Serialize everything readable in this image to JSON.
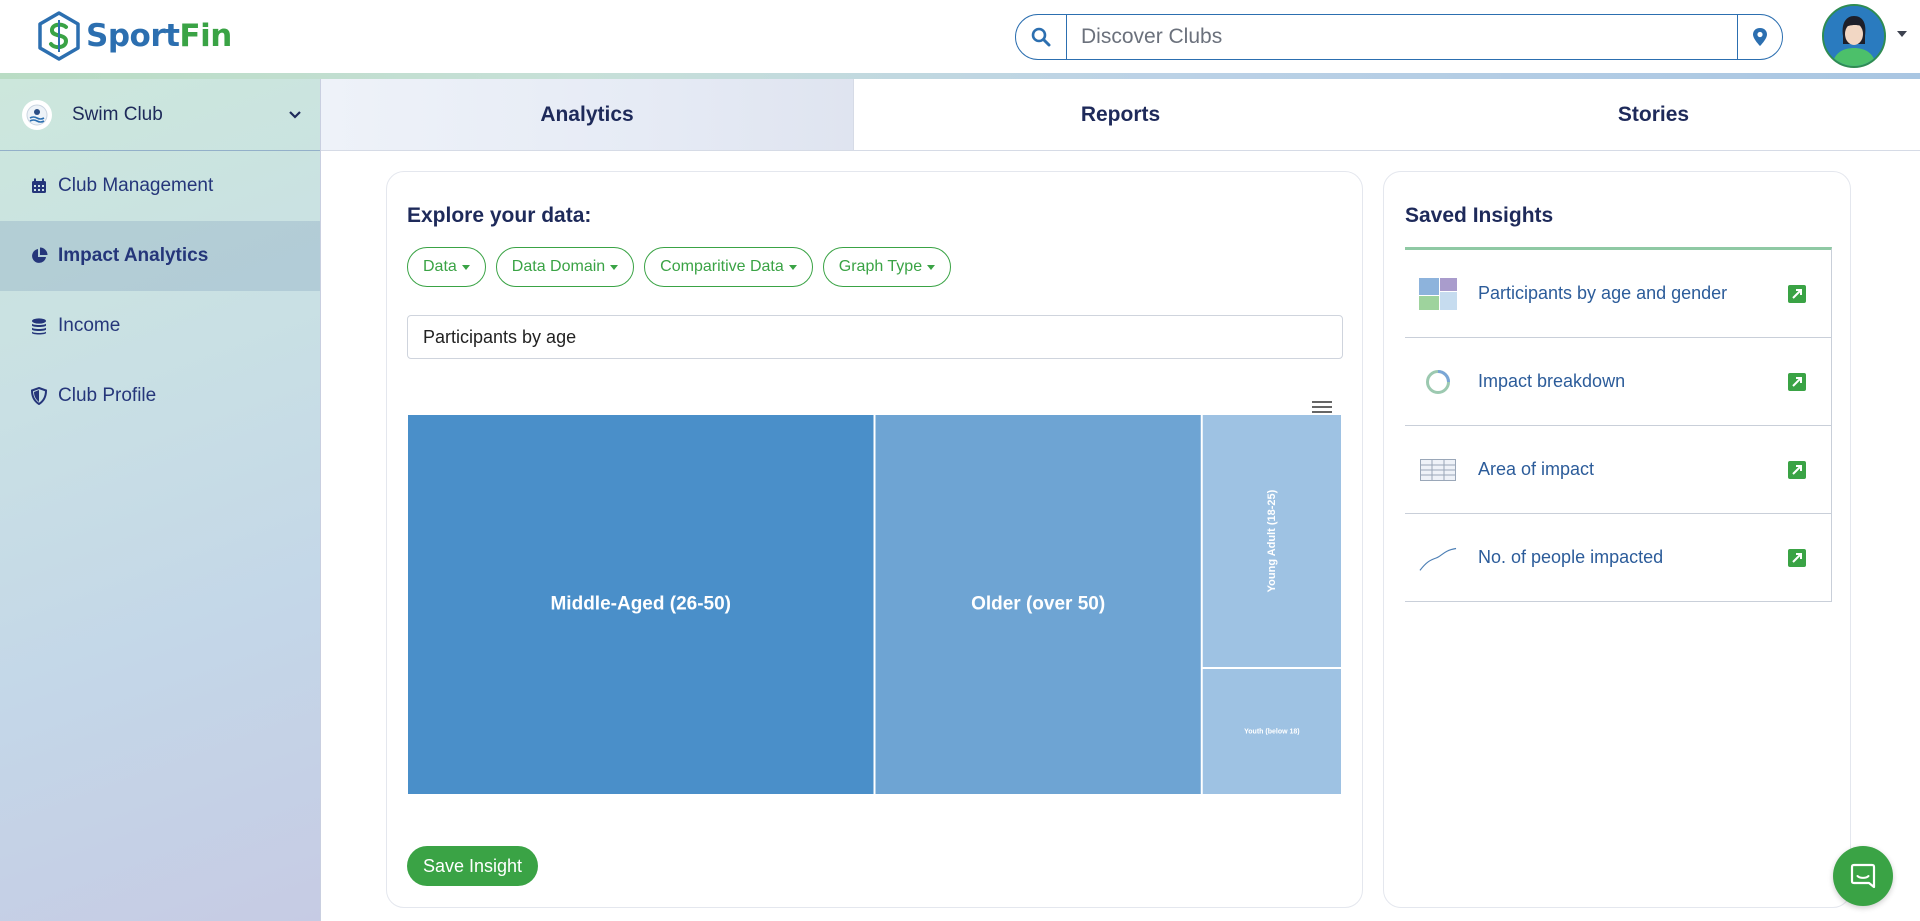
{
  "brand": {
    "name_part1": "Sport",
    "name_part2": "Fin",
    "primary_color": "#2c6fb0",
    "accent_color": "#3aa345"
  },
  "header": {
    "search_placeholder": "Discover Clubs",
    "search_icon": "search-icon",
    "location_icon": "map-pin-icon",
    "avatar_icon": "user-avatar"
  },
  "sidebar": {
    "club": {
      "name": "Swim Club",
      "icon": "chevron-down-icon"
    },
    "items": [
      {
        "label": "Club Management",
        "icon": "calendar-icon",
        "active": false
      },
      {
        "label": "Impact Analytics",
        "icon": "pie-chart-icon",
        "active": true
      },
      {
        "label": "Income",
        "icon": "coins-icon",
        "active": false
      },
      {
        "label": "Club Profile",
        "icon": "shield-icon",
        "active": false
      }
    ]
  },
  "tabs": [
    {
      "label": "Analytics",
      "active": true
    },
    {
      "label": "Reports",
      "active": false
    },
    {
      "label": "Stories",
      "active": false
    }
  ],
  "explore": {
    "title": "Explore your data:",
    "filters": [
      "Data",
      "Data Domain",
      "Comparitive Data",
      "Graph Type"
    ],
    "query": "Participants by age",
    "save_label": "Save Insight"
  },
  "chart_data": {
    "type": "treemap",
    "categories": [
      "Middle-Aged (26-50)",
      "Older (over 50)",
      "Young Adult (18-25)",
      "Youth (below 18)"
    ],
    "values": [
      50,
      35,
      10,
      5
    ],
    "colors": [
      "#4a8fc9",
      "#6ea4d3",
      "#9ec2e3",
      "#9ec2e3"
    ]
  },
  "saved_insights": {
    "title": "Saved Insights",
    "items": [
      {
        "label": "Participants by age and gender",
        "icon": "treemap-thumbnail-icon"
      },
      {
        "label": "Impact breakdown",
        "icon": "donut-thumbnail-icon"
      },
      {
        "label": "Area of impact",
        "icon": "table-thumbnail-icon"
      },
      {
        "label": "No. of people impacted",
        "icon": "line-thumbnail-icon"
      }
    ]
  }
}
